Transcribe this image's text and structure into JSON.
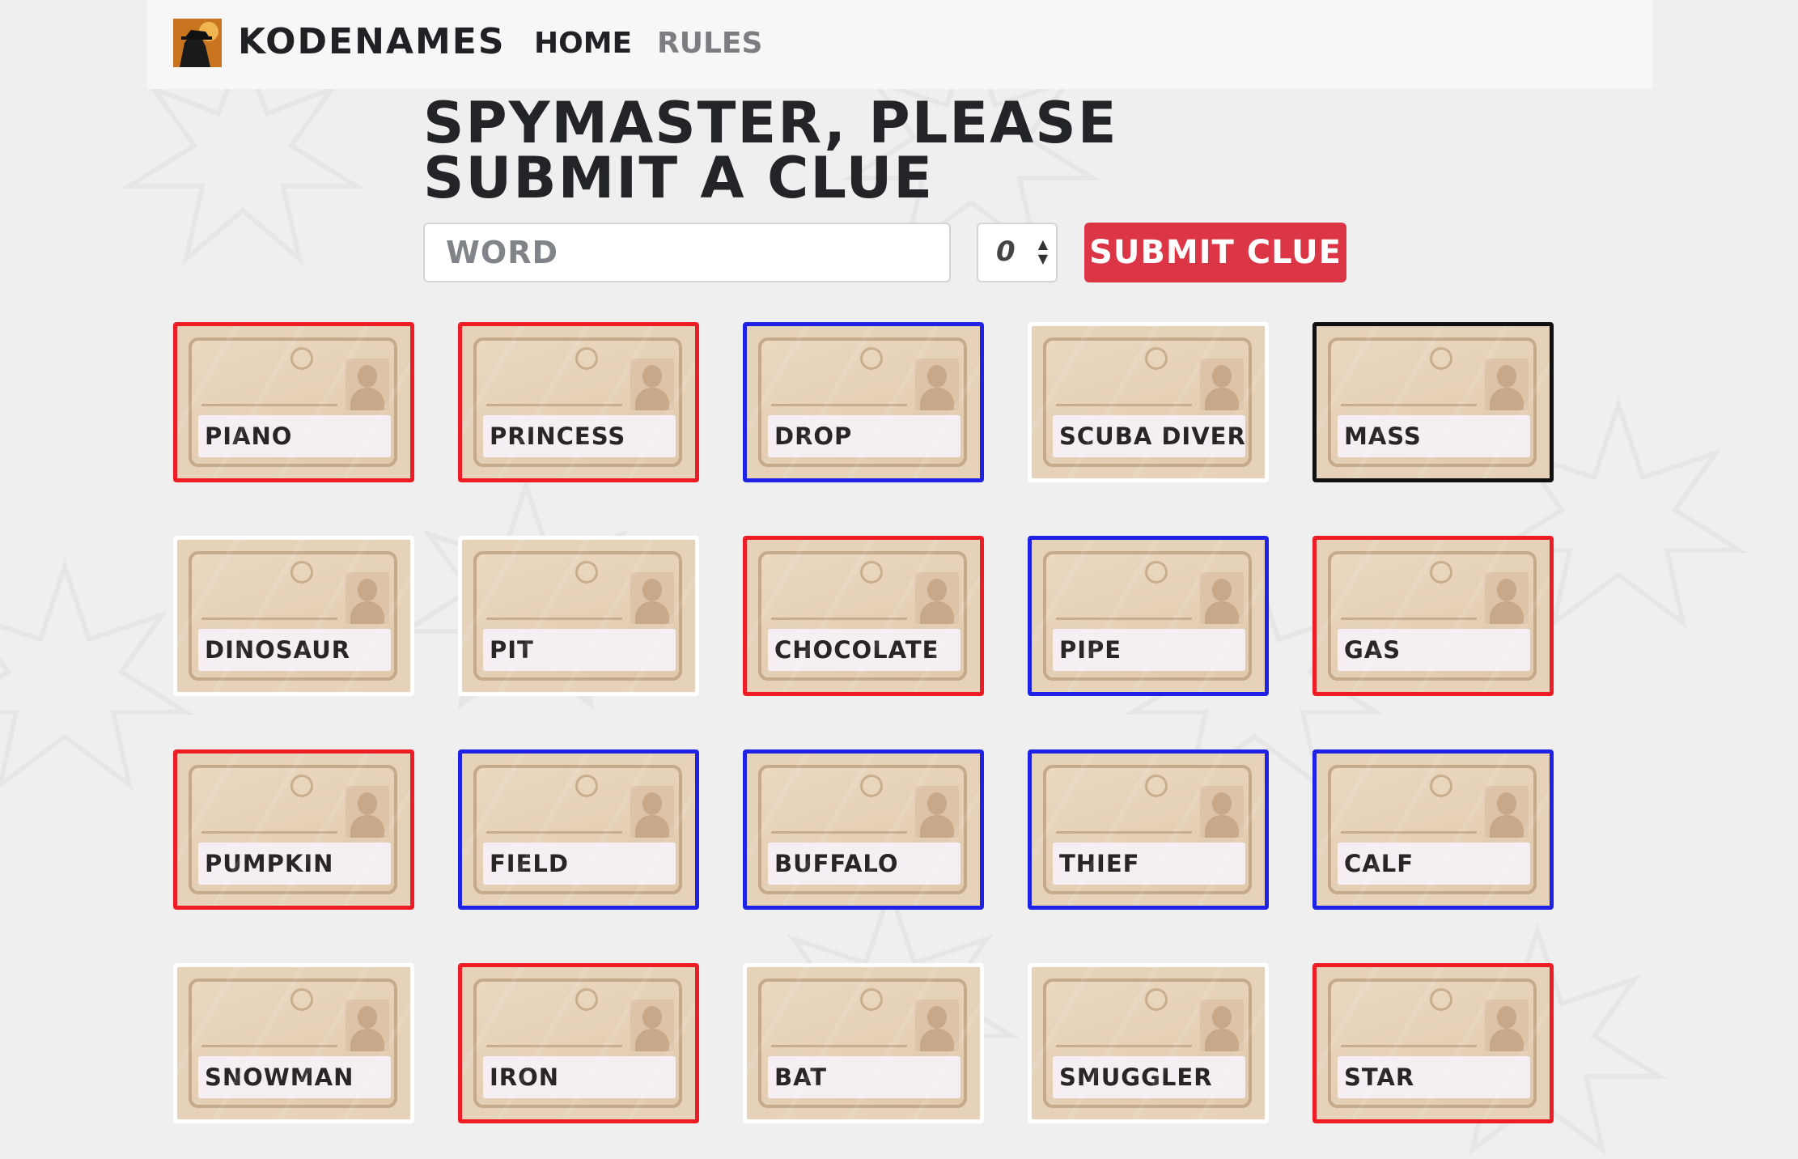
{
  "nav": {
    "brand": "KODENAMES",
    "home": "HOME",
    "rules": "RULES"
  },
  "clue_form": {
    "prompt": "SPYMASTER, PLEASE SUBMIT A CLUE",
    "word_placeholder": "WORD",
    "number_value": "0",
    "submit_label": "SUBMIT CLUE"
  },
  "colors": {
    "red_team": "#ee1c25",
    "blue_team": "#1f22e4",
    "assassin": "#111111",
    "neutral": "#ffffff",
    "submit_button": "#dc3545"
  },
  "cards": [
    {
      "word": "PIANO",
      "team": "red"
    },
    {
      "word": "PRINCESS",
      "team": "red"
    },
    {
      "word": "DROP",
      "team": "blue"
    },
    {
      "word": "SCUBA DIVER",
      "team": "neutral"
    },
    {
      "word": "MASS",
      "team": "black"
    },
    {
      "word": "DINOSAUR",
      "team": "neutral"
    },
    {
      "word": "PIT",
      "team": "neutral"
    },
    {
      "word": "CHOCOLATE",
      "team": "red"
    },
    {
      "word": "PIPE",
      "team": "blue"
    },
    {
      "word": "GAS",
      "team": "red"
    },
    {
      "word": "PUMPKIN",
      "team": "red"
    },
    {
      "word": "FIELD",
      "team": "blue"
    },
    {
      "word": "BUFFALO",
      "team": "blue"
    },
    {
      "word": "THIEF",
      "team": "blue"
    },
    {
      "word": "CALF",
      "team": "blue"
    },
    {
      "word": "SNOWMAN",
      "team": "neutral"
    },
    {
      "word": "IRON",
      "team": "red"
    },
    {
      "word": "BAT",
      "team": "neutral"
    },
    {
      "word": "SMUGGLER",
      "team": "neutral"
    },
    {
      "word": "STAR",
      "team": "red"
    }
  ]
}
